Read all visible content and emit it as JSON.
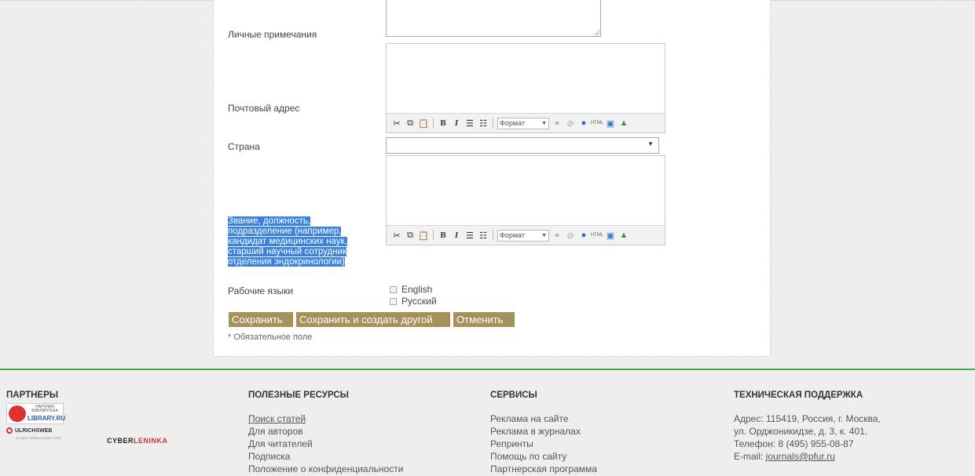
{
  "form": {
    "notes_label": "Личные примечания",
    "address_label": "Почтовый адрес",
    "country_label": "Страна",
    "position_label": "Звание, должность, подразделение (например, кандидат медицинских наук, старший научный сотрудник отделения эндокринологии)",
    "languages_label": "Рабочие языки",
    "languages": [
      "English",
      "Русский"
    ],
    "editor_format_label": "Формат",
    "buttons": {
      "save": "Сохранить",
      "save_and_create": "Сохранить и создать другой",
      "cancel": "Отменить"
    },
    "required_note": "* Обязательное поле"
  },
  "footer": {
    "partners": {
      "heading": "ПАРТНЕРЫ",
      "elibrary_top": "НАУЧНАЯ БИБЛИОТЕКА",
      "elibrary_name": "LIBRARY.RU",
      "ulrichs": "ULRICHSWEB",
      "ulrichs_sub": "GLOBAL SERIALS DIRECTORY",
      "cyberleninka_a": "CYBER",
      "cyberleninka_b": "LENINKA"
    },
    "resources": {
      "heading": "ПОЛЕЗНЫЕ РЕСУРСЫ",
      "links": [
        "Поиск статей",
        "Для авторов",
        "Для читателей",
        "Подписка",
        "Положение о конфиденциальности"
      ]
    },
    "services": {
      "heading": "СЕРВИСЫ",
      "links": [
        "Реклама на сайте",
        "Реклама в журналах",
        "Репринты",
        "Помощь по сайту",
        "Партнерская программа"
      ]
    },
    "support": {
      "heading": "ТЕХНИЧЕСКАЯ ПОДДЕРЖКА",
      "address1": "Адрес: 115419, Россия, г. Москва,",
      "address2": "ул. Орджоникидзе, д. 3, к. 401.",
      "phone": "Телефон: 8 (495) 955-08-87",
      "email_prefix": "E-mail: ",
      "email": "journals@pfur.ru"
    }
  }
}
